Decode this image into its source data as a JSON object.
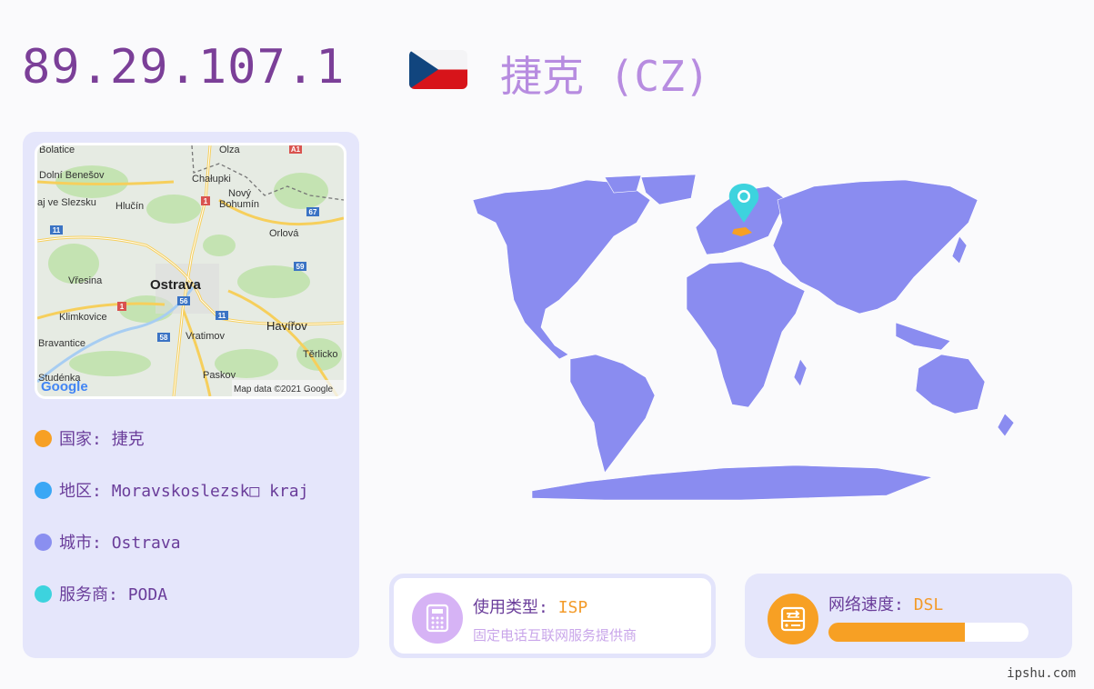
{
  "header": {
    "ip": "89.29.107.1",
    "country_title": "捷克 (CZ)",
    "flag": "czech-flag"
  },
  "map": {
    "attribution": "Map data ©2021 Google",
    "logo": "Google",
    "labels": {
      "ostrava": "Ostrava",
      "havirov": "Havířov",
      "hlucin": "Hlučín",
      "orlova": "Orlová",
      "novy": "Nový",
      "bohumin": "Bohumín",
      "chalupki": "Chałupki",
      "olza": "Olza",
      "dolni": "Dolní Benešov",
      "slezsku": "aj ve Slezsku",
      "vresina": "Vřesina",
      "klimkovice": "Klimkovice",
      "bravantice": "Bravantice",
      "vratimov": "Vratimov",
      "paskov": "Paskov",
      "terlicko": "Těrlicko",
      "sedenka": "Studénka",
      "bolatice": "Bolatice"
    },
    "roads": {
      "r1a": "1",
      "r1b": "1",
      "r11a": "11",
      "r11b": "11",
      "r56": "56",
      "r58": "58",
      "r59": "59",
      "r67": "67",
      "a1": "A1"
    }
  },
  "info": {
    "country": {
      "label": "国家: ",
      "value": "捷克",
      "color": "#f7a024"
    },
    "region": {
      "label": "地区: ",
      "value": "Moravskoslezsk□ kraj",
      "color": "#3aa7f5"
    },
    "city": {
      "label": "城市: ",
      "value": "Ostrava",
      "color": "#8a8ff0"
    },
    "isp": {
      "label": "服务商: ",
      "value": "PODA",
      "color": "#3dd3de"
    }
  },
  "usage": {
    "label": "使用类型: ",
    "value": "ISP",
    "sub": "固定电话互联网服务提供商",
    "icon": "phone-icon"
  },
  "speed": {
    "label": "网络速度: ",
    "value": "DSL",
    "progress": 0.68,
    "icon": "harddrive-icon"
  },
  "watermark": "ipshu.com"
}
